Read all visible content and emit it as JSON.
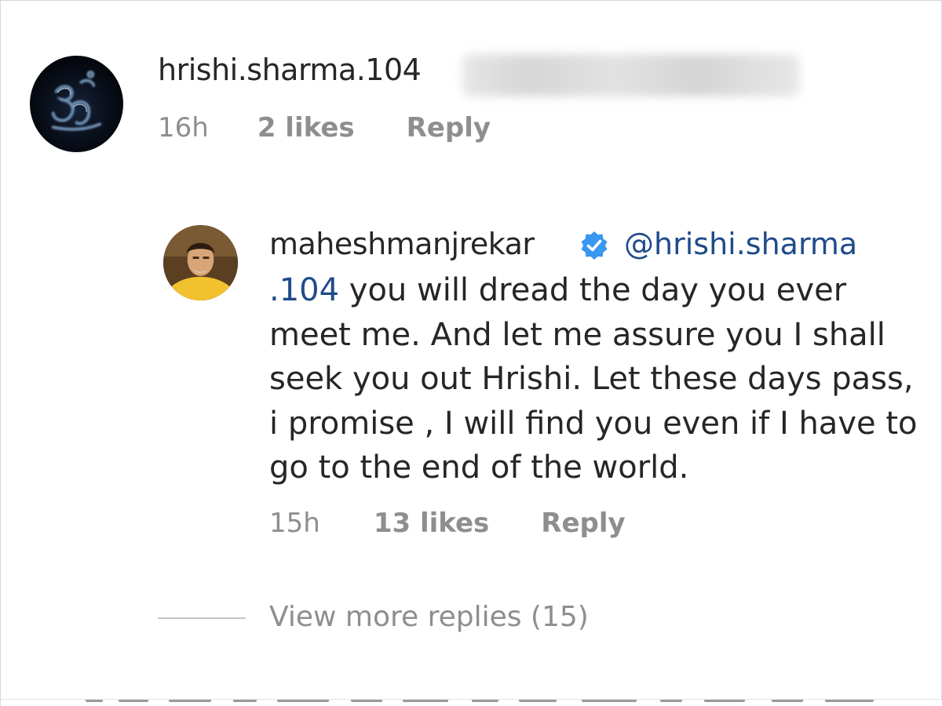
{
  "comment": {
    "username": "hrishi.sharma.104",
    "avatar_icon": "om-symbol-icon",
    "time": "16h",
    "likes": "2 likes",
    "reply_label": "Reply"
  },
  "reply": {
    "username": "maheshmanjrekar",
    "verified_icon": "verified-badge-icon",
    "verified_color": "#3897f0",
    "mention_part1": "@hrishi.sharma",
    "mention_part2": ".104",
    "line1_rest": " you will dread the day you ever",
    "line2": "meet me. And let me assure you I shall",
    "line3": "seek you out Hrishi. Let these days pass,",
    "line4": "i promise , I will find you even if I have to",
    "line5": "go to the end of the world.",
    "time": "15h",
    "likes": "13 likes",
    "reply_label": "Reply"
  },
  "view_more": "View more replies (15)",
  "colors": {
    "text": "#262626",
    "secondary": "#8e8e8e",
    "mention": "#1f4b8a"
  }
}
